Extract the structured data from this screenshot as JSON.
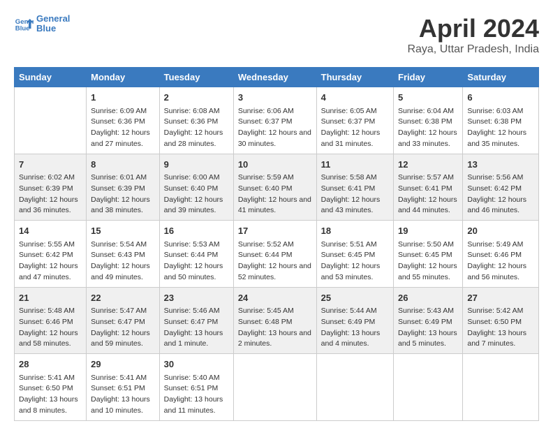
{
  "header": {
    "logo_line1": "General",
    "logo_line2": "Blue",
    "title": "April 2024",
    "subtitle": "Raya, Uttar Pradesh, India"
  },
  "days_of_week": [
    "Sunday",
    "Monday",
    "Tuesday",
    "Wednesday",
    "Thursday",
    "Friday",
    "Saturday"
  ],
  "weeks": [
    [
      {
        "day": "",
        "sunrise": "",
        "sunset": "",
        "daylight": ""
      },
      {
        "day": "1",
        "sunrise": "Sunrise: 6:09 AM",
        "sunset": "Sunset: 6:36 PM",
        "daylight": "Daylight: 12 hours and 27 minutes."
      },
      {
        "day": "2",
        "sunrise": "Sunrise: 6:08 AM",
        "sunset": "Sunset: 6:36 PM",
        "daylight": "Daylight: 12 hours and 28 minutes."
      },
      {
        "day": "3",
        "sunrise": "Sunrise: 6:06 AM",
        "sunset": "Sunset: 6:37 PM",
        "daylight": "Daylight: 12 hours and 30 minutes."
      },
      {
        "day": "4",
        "sunrise": "Sunrise: 6:05 AM",
        "sunset": "Sunset: 6:37 PM",
        "daylight": "Daylight: 12 hours and 31 minutes."
      },
      {
        "day": "5",
        "sunrise": "Sunrise: 6:04 AM",
        "sunset": "Sunset: 6:38 PM",
        "daylight": "Daylight: 12 hours and 33 minutes."
      },
      {
        "day": "6",
        "sunrise": "Sunrise: 6:03 AM",
        "sunset": "Sunset: 6:38 PM",
        "daylight": "Daylight: 12 hours and 35 minutes."
      }
    ],
    [
      {
        "day": "7",
        "sunrise": "Sunrise: 6:02 AM",
        "sunset": "Sunset: 6:39 PM",
        "daylight": "Daylight: 12 hours and 36 minutes."
      },
      {
        "day": "8",
        "sunrise": "Sunrise: 6:01 AM",
        "sunset": "Sunset: 6:39 PM",
        "daylight": "Daylight: 12 hours and 38 minutes."
      },
      {
        "day": "9",
        "sunrise": "Sunrise: 6:00 AM",
        "sunset": "Sunset: 6:40 PM",
        "daylight": "Daylight: 12 hours and 39 minutes."
      },
      {
        "day": "10",
        "sunrise": "Sunrise: 5:59 AM",
        "sunset": "Sunset: 6:40 PM",
        "daylight": "Daylight: 12 hours and 41 minutes."
      },
      {
        "day": "11",
        "sunrise": "Sunrise: 5:58 AM",
        "sunset": "Sunset: 6:41 PM",
        "daylight": "Daylight: 12 hours and 43 minutes."
      },
      {
        "day": "12",
        "sunrise": "Sunrise: 5:57 AM",
        "sunset": "Sunset: 6:41 PM",
        "daylight": "Daylight: 12 hours and 44 minutes."
      },
      {
        "day": "13",
        "sunrise": "Sunrise: 5:56 AM",
        "sunset": "Sunset: 6:42 PM",
        "daylight": "Daylight: 12 hours and 46 minutes."
      }
    ],
    [
      {
        "day": "14",
        "sunrise": "Sunrise: 5:55 AM",
        "sunset": "Sunset: 6:42 PM",
        "daylight": "Daylight: 12 hours and 47 minutes."
      },
      {
        "day": "15",
        "sunrise": "Sunrise: 5:54 AM",
        "sunset": "Sunset: 6:43 PM",
        "daylight": "Daylight: 12 hours and 49 minutes."
      },
      {
        "day": "16",
        "sunrise": "Sunrise: 5:53 AM",
        "sunset": "Sunset: 6:44 PM",
        "daylight": "Daylight: 12 hours and 50 minutes."
      },
      {
        "day": "17",
        "sunrise": "Sunrise: 5:52 AM",
        "sunset": "Sunset: 6:44 PM",
        "daylight": "Daylight: 12 hours and 52 minutes."
      },
      {
        "day": "18",
        "sunrise": "Sunrise: 5:51 AM",
        "sunset": "Sunset: 6:45 PM",
        "daylight": "Daylight: 12 hours and 53 minutes."
      },
      {
        "day": "19",
        "sunrise": "Sunrise: 5:50 AM",
        "sunset": "Sunset: 6:45 PM",
        "daylight": "Daylight: 12 hours and 55 minutes."
      },
      {
        "day": "20",
        "sunrise": "Sunrise: 5:49 AM",
        "sunset": "Sunset: 6:46 PM",
        "daylight": "Daylight: 12 hours and 56 minutes."
      }
    ],
    [
      {
        "day": "21",
        "sunrise": "Sunrise: 5:48 AM",
        "sunset": "Sunset: 6:46 PM",
        "daylight": "Daylight: 12 hours and 58 minutes."
      },
      {
        "day": "22",
        "sunrise": "Sunrise: 5:47 AM",
        "sunset": "Sunset: 6:47 PM",
        "daylight": "Daylight: 12 hours and 59 minutes."
      },
      {
        "day": "23",
        "sunrise": "Sunrise: 5:46 AM",
        "sunset": "Sunset: 6:47 PM",
        "daylight": "Daylight: 13 hours and 1 minute."
      },
      {
        "day": "24",
        "sunrise": "Sunrise: 5:45 AM",
        "sunset": "Sunset: 6:48 PM",
        "daylight": "Daylight: 13 hours and 2 minutes."
      },
      {
        "day": "25",
        "sunrise": "Sunrise: 5:44 AM",
        "sunset": "Sunset: 6:49 PM",
        "daylight": "Daylight: 13 hours and 4 minutes."
      },
      {
        "day": "26",
        "sunrise": "Sunrise: 5:43 AM",
        "sunset": "Sunset: 6:49 PM",
        "daylight": "Daylight: 13 hours and 5 minutes."
      },
      {
        "day": "27",
        "sunrise": "Sunrise: 5:42 AM",
        "sunset": "Sunset: 6:50 PM",
        "daylight": "Daylight: 13 hours and 7 minutes."
      }
    ],
    [
      {
        "day": "28",
        "sunrise": "Sunrise: 5:41 AM",
        "sunset": "Sunset: 6:50 PM",
        "daylight": "Daylight: 13 hours and 8 minutes."
      },
      {
        "day": "29",
        "sunrise": "Sunrise: 5:41 AM",
        "sunset": "Sunset: 6:51 PM",
        "daylight": "Daylight: 13 hours and 10 minutes."
      },
      {
        "day": "30",
        "sunrise": "Sunrise: 5:40 AM",
        "sunset": "Sunset: 6:51 PM",
        "daylight": "Daylight: 13 hours and 11 minutes."
      },
      {
        "day": "",
        "sunrise": "",
        "sunset": "",
        "daylight": ""
      },
      {
        "day": "",
        "sunrise": "",
        "sunset": "",
        "daylight": ""
      },
      {
        "day": "",
        "sunrise": "",
        "sunset": "",
        "daylight": ""
      },
      {
        "day": "",
        "sunrise": "",
        "sunset": "",
        "daylight": ""
      }
    ]
  ]
}
